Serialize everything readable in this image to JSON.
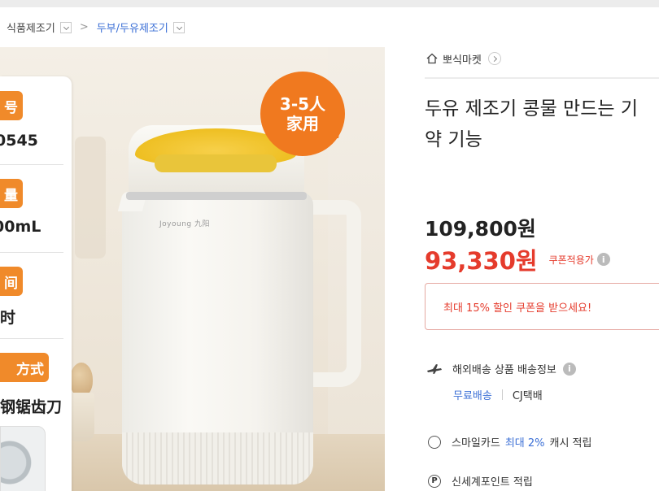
{
  "breadcrumb": {
    "items": [
      {
        "label": "식품제조기",
        "color": "#444444"
      },
      {
        "label": "두부/두유제조기",
        "color": "#3b6fd6"
      }
    ],
    "separator": ">"
  },
  "product_image": {
    "badge_line1": "3-5人",
    "badge_line2": "家用",
    "badge_color": "#f0791f",
    "brand": "Joyoung 九阳",
    "specs": [
      {
        "tag": "号",
        "value": "0545"
      },
      {
        "tag": "量",
        "value": "00mL"
      },
      {
        "tag": "间",
        "value": "时"
      },
      {
        "tag": "方式",
        "value": "钢锯齿刀"
      }
    ]
  },
  "store": {
    "name": "뽀식마켓",
    "icon": "home-icon"
  },
  "product": {
    "title": "두유 제조기 콩물 만드는 기\n약 기능"
  },
  "price": {
    "original": "109,800원",
    "sale": "93,330원",
    "sale_note": "쿠폰적용가",
    "sale_color": "#e53b2c"
  },
  "coupon": {
    "label": "최대 15% 할인 쿠폰을 받으세요!"
  },
  "shipping": {
    "label": "해외배송 상품 배송정보",
    "free": "무료배송",
    "carrier": "CJ택배"
  },
  "smile_card": {
    "prefix": "스마일카드",
    "highlight": "최대 2%",
    "suffix": "캐시 적립"
  },
  "points": {
    "label": "신세계포인트 적립"
  }
}
